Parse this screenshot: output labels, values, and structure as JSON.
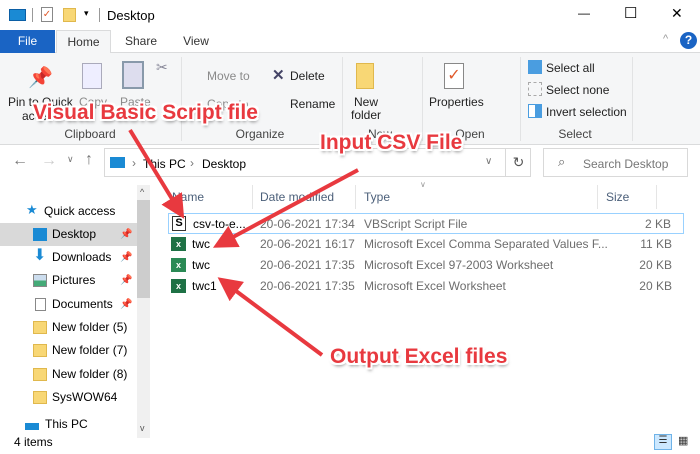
{
  "window": {
    "title": "Desktop",
    "min": "—",
    "max": "☐",
    "close": "✕",
    "help": "?"
  },
  "tabs": [
    {
      "label": "File"
    },
    {
      "label": "Home"
    },
    {
      "label": "Share"
    },
    {
      "label": "View"
    }
  ],
  "ribbon": {
    "clipboard": {
      "label": "Clipboard",
      "pin": "Pin to Quick",
      "pin2": "access",
      "copy": "Copy",
      "paste": "Paste"
    },
    "organize": {
      "label": "Organize",
      "move": "Move to",
      "copy": "Copy to",
      "delete": "Delete",
      "rename": "Rename"
    },
    "new": {
      "label": "New",
      "folder": "New",
      "folder2": "folder"
    },
    "open": {
      "label": "Open",
      "properties": "Properties"
    },
    "select": {
      "label": "Select",
      "all": "Select all",
      "none": "Select none",
      "invert": "Invert selection"
    }
  },
  "address": {
    "crumbs": [
      "This PC",
      "Desktop"
    ],
    "search_placeholder": "Search Desktop"
  },
  "sidebar": {
    "quick_access": "Quick access",
    "items": [
      {
        "label": "Desktop",
        "pinned": true
      },
      {
        "label": "Downloads",
        "pinned": true
      },
      {
        "label": "Pictures",
        "pinned": true
      },
      {
        "label": "Documents",
        "pinned": true
      },
      {
        "label": "New folder (5)"
      },
      {
        "label": "New folder (7)"
      },
      {
        "label": "New folder (8)"
      },
      {
        "label": "SysWOW64"
      }
    ],
    "this_pc": "This PC"
  },
  "columns": {
    "name": "Name",
    "date": "Date modified",
    "type": "Type",
    "size": "Size"
  },
  "files": [
    {
      "name": "csv-to-e...",
      "date": "20-06-2021 17:34",
      "type": "VBScript Script File",
      "size": "2 KB"
    },
    {
      "name": "twc",
      "date": "20-06-2021 16:17",
      "type": "Microsoft Excel Comma Separated Values F...",
      "size": "11 KB"
    },
    {
      "name": "twc",
      "date": "20-06-2021 17:35",
      "type": "Microsoft Excel 97-2003 Worksheet",
      "size": "20 KB"
    },
    {
      "name": "twc1",
      "date": "20-06-2021 17:35",
      "type": "Microsoft Excel Worksheet",
      "size": "20 KB"
    }
  ],
  "status": {
    "items": "4 items"
  },
  "annotations": {
    "vbs": "Visual Basic Script file",
    "csv": "Input CSV File",
    "out": "Output Excel files"
  },
  "colors": {
    "accent": "#1a64c4",
    "annotation": "#e8393f",
    "selected": "#cce8ff"
  }
}
